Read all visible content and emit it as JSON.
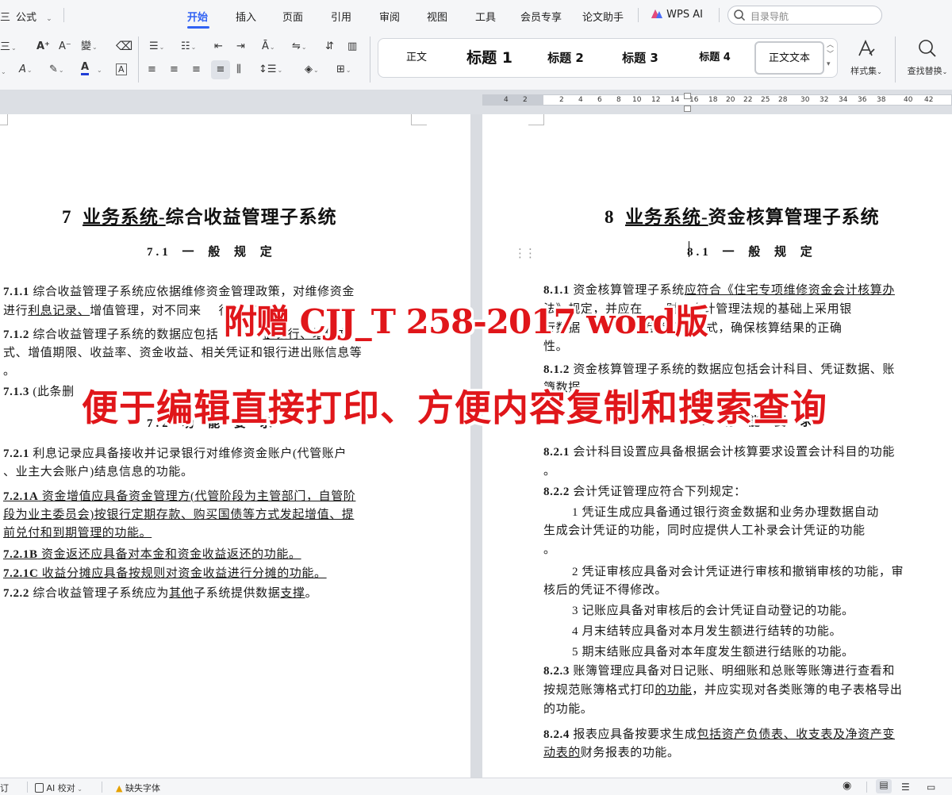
{
  "menubar": {
    "left_cut": "三",
    "formula": "公式",
    "tabs": [
      "开始",
      "插入",
      "页面",
      "引用",
      "审阅",
      "视图",
      "工具",
      "会员专享",
      "论文助手"
    ],
    "wps_ai": "WPS AI",
    "search_placeholder": "目录导航"
  },
  "toolbar": {
    "styles": {
      "body": "正文",
      "h1": "标题 1",
      "h2": "标题 2",
      "h3": "标题 3",
      "h4": "标题 4",
      "body_text": "正文文本"
    },
    "style_set_label": "样式集",
    "find_replace_label": "查找替换"
  },
  "ruler": {
    "numbers": [
      "4",
      "2",
      "2",
      "4",
      "6",
      "8",
      "10",
      "12",
      "14",
      "16",
      "18",
      "20",
      "22",
      "25",
      "28",
      "30",
      "32",
      "34",
      "36",
      "38",
      "40",
      "42"
    ]
  },
  "left_page": {
    "chapter_num": "7",
    "chapter_title_u": "业务系统-",
    "chapter_title_rest": "综合收益管理子系统",
    "section_7_1": "7.1 一 般 规 定",
    "c711_num": "7.1.1",
    "c711_l1": "综合收益管理子系统应依据维修资金管理政策，对维修资金",
    "c711_l2a": "进行",
    "c711_l2u": "利息记录、",
    "c711_l2b": "增值管理，对不同来",
    "c711_l2c": "行",
    "c711_l2d": "功能。",
    "c712_num": "7.1.2",
    "c712_l1a": "综合收益管理子系统的数据应包括",
    "c712_l1b": "值银行、增值方",
    "c712_l2": "式、增值期限、收益率、资金收益、相关凭证和银行进出账信息等",
    "c712_l3": "。",
    "c713_num": "7.1.3",
    "c713_text": "(此条删",
    "section_7_2": "7.2 功 能 要 求",
    "c721_num": "7.2.1",
    "c721_l1": "利息记录应具备接收并记录银行对维修资金账户(代管账户",
    "c721_l2": "、业主大会账户)结息信息的功能。",
    "c721a_num": "7.2.1A",
    "c721a_l1": "资金增值应具备资金管理方(代管阶段为主管部门，自管阶",
    "c721a_l2": "段为业主委员会)按银行定期存款、购买国债等方式发起增值、提",
    "c721a_l3": "前兑付和到期管理的功能。",
    "c721b_num": "7.2.1B",
    "c721b_text": "资金返还应具备对本金和资金收益返还的功能。",
    "c721c_num": "7.2.1C",
    "c721c_text": "收益分摊应具备按规则对资金收益进行分摊的功能。",
    "c722_num": "7.2.2",
    "c722_a": "综合收益管理子系统应为",
    "c722_u1": "其他",
    "c722_b": "子系统提供数据",
    "c722_u2": "支撑",
    "c722_c": "。"
  },
  "right_page": {
    "chapter_num": "8",
    "chapter_title_u": "业务系统-",
    "chapter_title_rest": "资金核算管理子系统",
    "section_8_1": "8.1 一 般 规 定",
    "c811_num": "8.1.1",
    "c811_l1a": "资金核算管理子系统",
    "c811_l1u": "应符合《住宅专项维修资金会计核算办",
    "c811_l2a": "法》规定，并应在",
    "c811_l2b": "财务会计管理法规的基础上采用银",
    "c811_l3a": "行数据",
    "c811_l3b": "互验证的方式，确保核算结果的正确",
    "c811_l4": "性。",
    "c812_num": "8.1.2",
    "c812_l1": "资金核算管理子系统的数据应包括会计科目、凭证数据、账",
    "c812_l2": "簿数据",
    "section_8_2": "8.2 功 能 要 求",
    "c821_num": "8.2.1",
    "c821_l1": "会计科目设置应具备根据会计核算要求设置会计科目的功能",
    "c821_l2": "。",
    "c822_num": "8.2.2",
    "c822_text": "会计凭证管理应符合下列规定：",
    "c822_i1_l1": "1 凭证生成应具备通过银行资金数据和业务办理数据自动",
    "c822_i1_l2": "生成会计凭证的功能，同时应提供人工补录会计凭证的功能",
    "c822_i1_l3": "。",
    "c822_i2_l1": "2 凭证审核应具备对会计凭证进行审核和撤销审核的功能，审",
    "c822_i2_l2": "核后的凭证不得修改。",
    "c822_i3": "3 记账应具备对审核后的会计凭证自动登记的功能。",
    "c822_i4": "4 月末结转应具备对本月发生额进行结转的功能。",
    "c822_i5": "5 期末结账应具备对本年度发生额进行结账的功能。",
    "c823_num": "8.2.3",
    "c823_l1": "账簿管理应具备对日记账、明细账和总账等账簿进行查看和",
    "c823_l2a": "按规范账簿格式打印",
    "c823_l2u": "的功能",
    "c823_l2b": "，并应实现对各类账簿的电子表格导出",
    "c823_l3": "的功能。",
    "c824_num": "8.2.4",
    "c824_l1a": "报表应具备按要求生成",
    "c824_l1u": "包括资产负债表、收支表及净资产变",
    "c824_l2u": "动表的",
    "c824_l2b": "财务报表的功能。"
  },
  "overlay": {
    "line1": "附赠 CJJ_T 258-2017 word版",
    "line2": "便于编辑直接打印、方便内容复制和搜索查询"
  },
  "statusbar": {
    "left_cut": "订",
    "ai_check": "AI 校对",
    "missing_fonts": "缺失字体"
  },
  "colors": {
    "accent": "#3162f3",
    "overlay_red": "#e0161a"
  }
}
